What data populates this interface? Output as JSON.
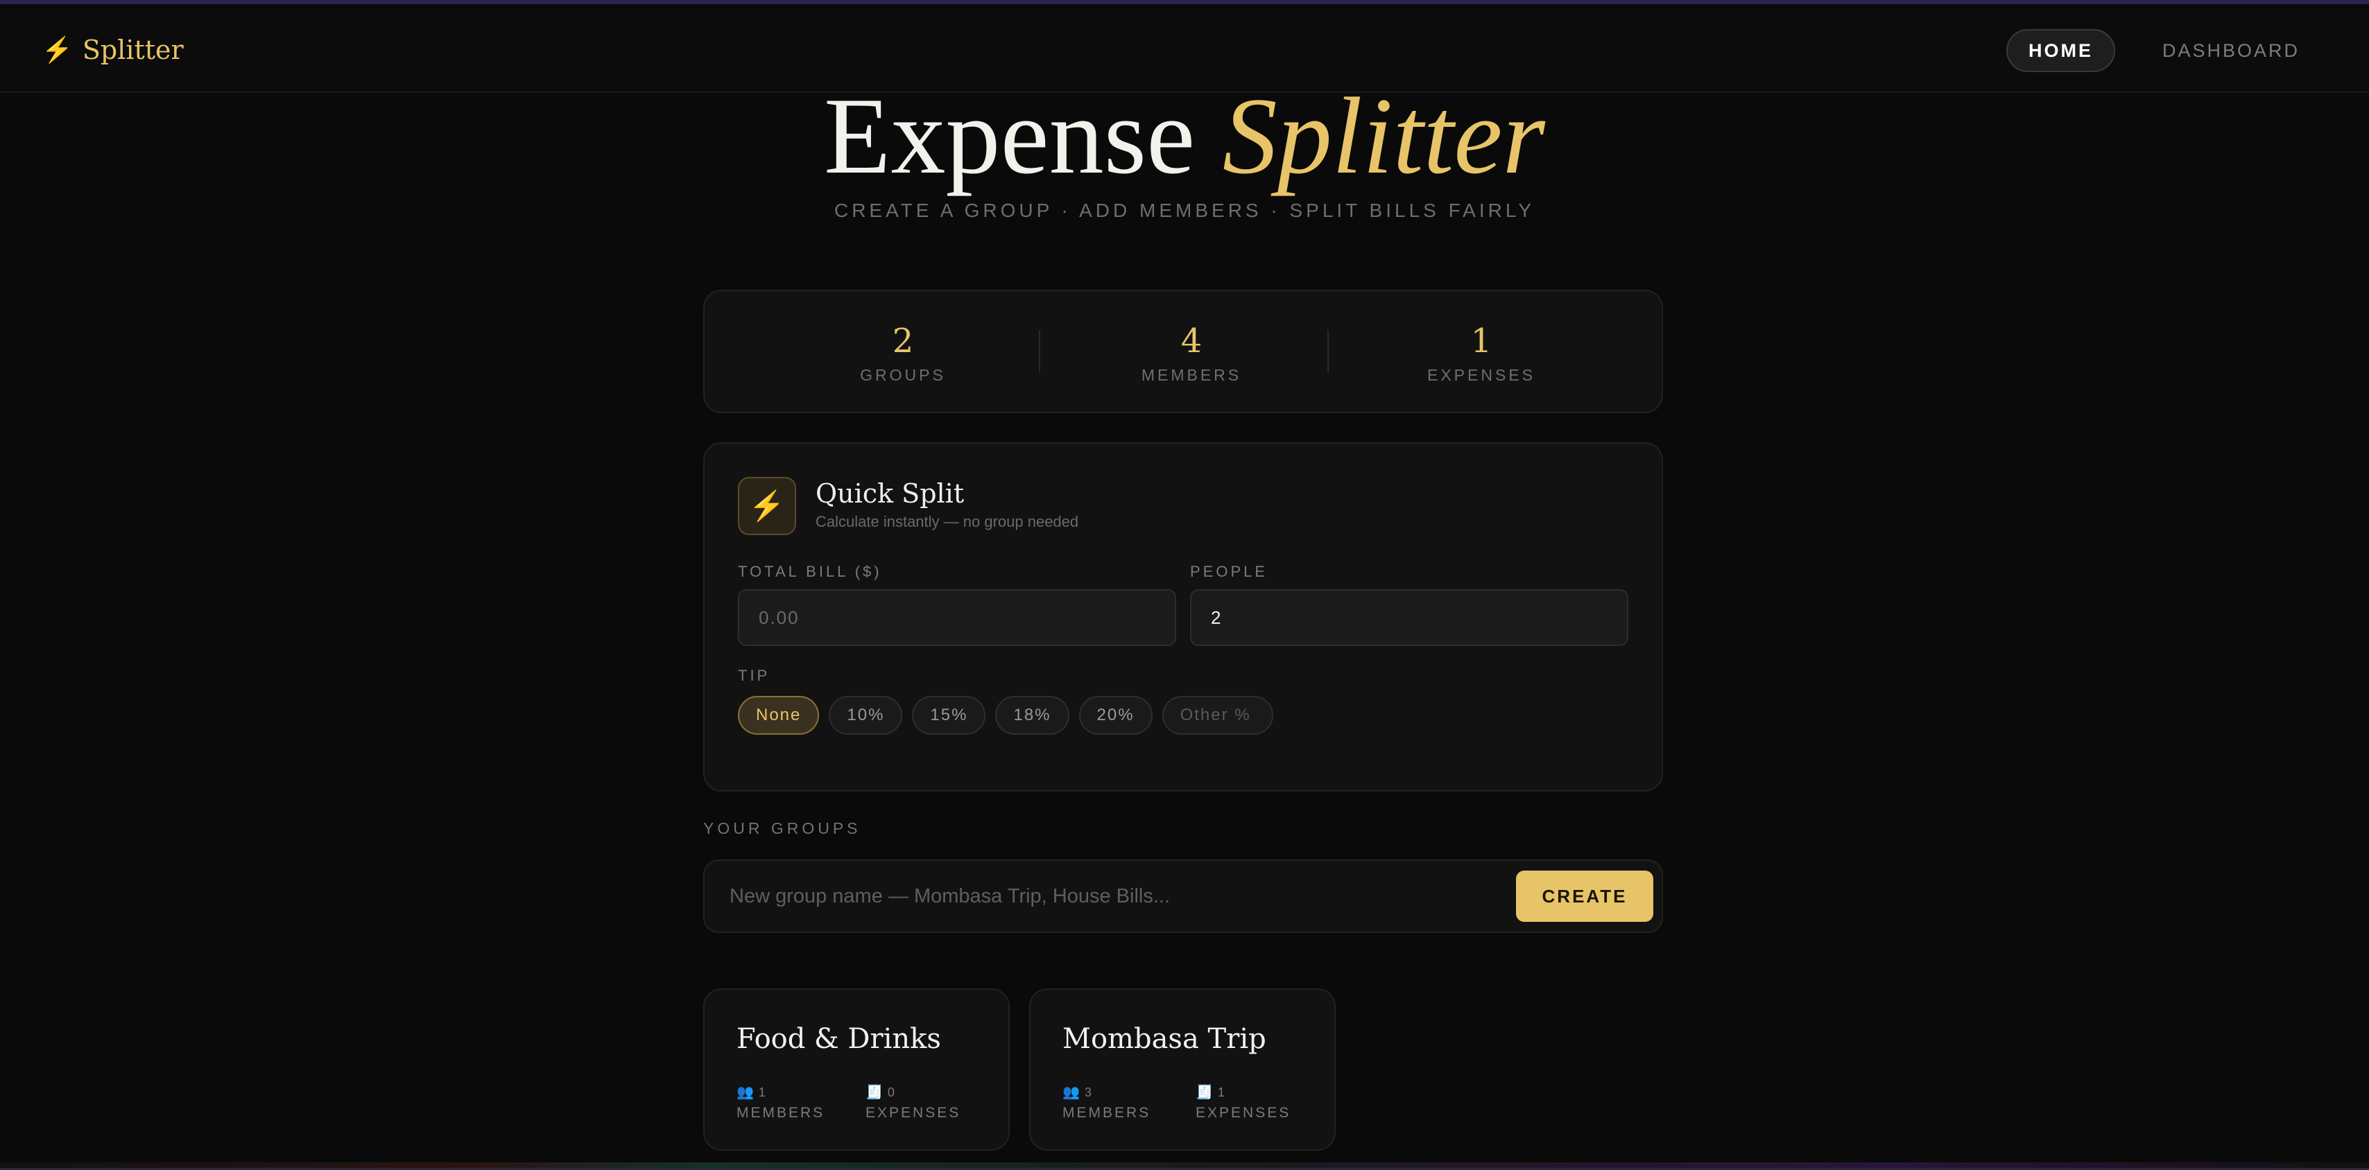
{
  "brand": {
    "icon": "lightning-bolt-icon",
    "name": "Splitter"
  },
  "nav": {
    "items": [
      {
        "label": "HOME",
        "active": true
      },
      {
        "label": "DASHBOARD",
        "active": false
      }
    ]
  },
  "hero": {
    "title_main": "Expense",
    "title_accent": "Splitter",
    "subtitle": "CREATE A GROUP · ADD MEMBERS · SPLIT BILLS FAIRLY"
  },
  "stats": [
    {
      "value": "2",
      "label": "GROUPS"
    },
    {
      "value": "4",
      "label": "MEMBERS"
    },
    {
      "value": "1",
      "label": "EXPENSES"
    }
  ],
  "quick_split": {
    "icon": "lightning-bolt-icon",
    "title": "Quick Split",
    "subtitle": "Calculate instantly — no group needed",
    "bill_label": "TOTAL BILL ($)",
    "bill_placeholder": "0.00",
    "people_label": "PEOPLE",
    "people_value": "2",
    "tip_label": "TIP",
    "tips": [
      "None",
      "10%",
      "15%",
      "18%",
      "20%"
    ],
    "tip_selected": "None",
    "tip_other_placeholder": "Other %"
  },
  "groups_section": {
    "label": "YOUR GROUPS",
    "input_placeholder": "New group name — Mombasa Trip, House Bills...",
    "create_label": "CREATE"
  },
  "groups": [
    {
      "name": "Food & Drinks",
      "members": "1",
      "members_label": "MEMBERS",
      "expenses": "0",
      "expenses_label": "EXPENSES"
    },
    {
      "name": "Mombasa Trip",
      "members": "3",
      "members_label": "MEMBERS",
      "expenses": "1",
      "expenses_label": "EXPENSES"
    }
  ],
  "colors": {
    "accent": "#e8c468",
    "background": "#0a0a0a",
    "card": "#121212"
  }
}
